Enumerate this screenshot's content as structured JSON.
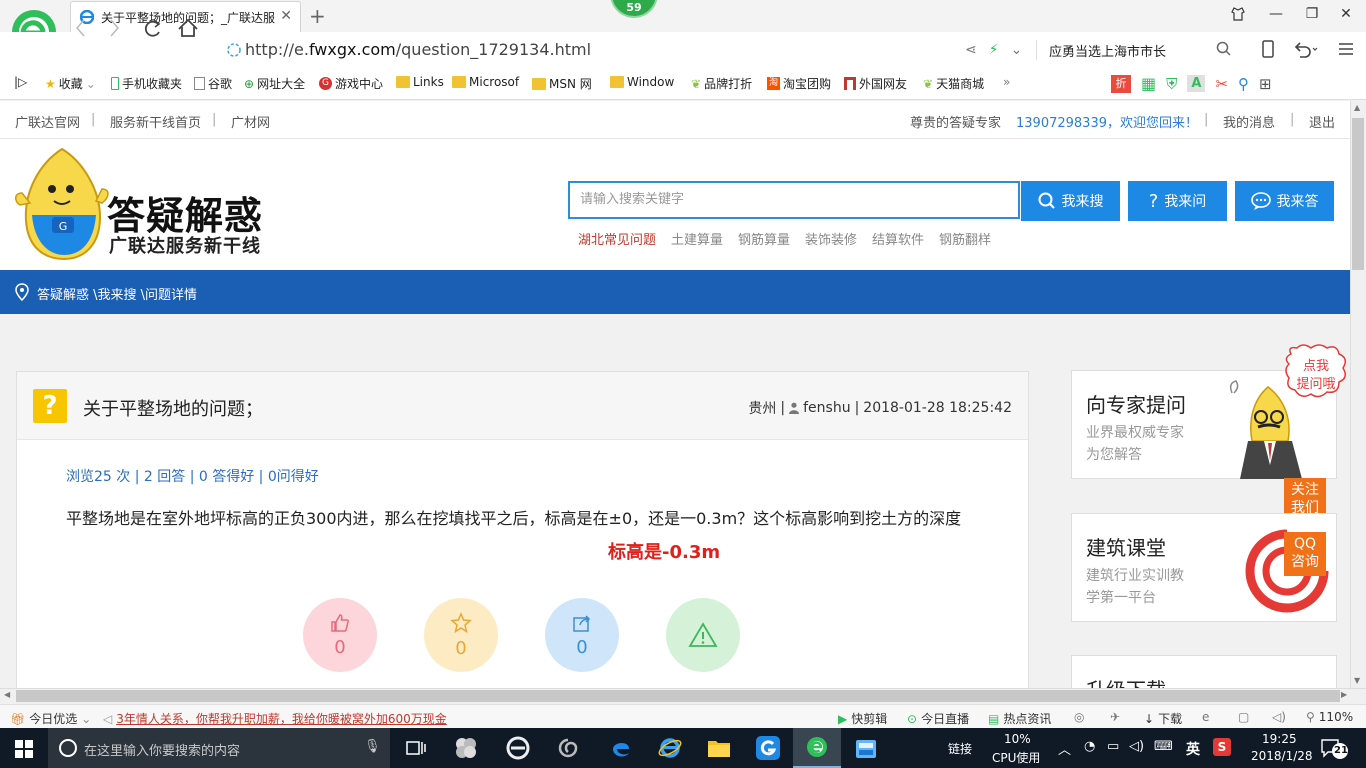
{
  "browser": {
    "tab_title": "关于平整场地的问题；_广联达服",
    "notification_count": "59",
    "url_prefix": "http://e.",
    "url_domain": "fwxgx.com",
    "url_path": "/question_1729134.html",
    "search_text": "应勇当选上海市市长"
  },
  "bookmarks": [
    {
      "label": "收藏",
      "icon": "star-icon"
    },
    {
      "label": "手机收藏夹",
      "icon": "phone-icon"
    },
    {
      "label": "谷歌",
      "icon": "page-icon"
    },
    {
      "label": "网址大全",
      "icon": "globe-icon"
    },
    {
      "label": "游戏中心",
      "icon": "game-icon"
    },
    {
      "label": "Links",
      "icon": "folder-icon"
    },
    {
      "label": "Microsof",
      "icon": "folder-icon"
    },
    {
      "label": "MSN 网",
      "icon": "folder-icon"
    },
    {
      "label": "Window",
      "icon": "folder-icon"
    },
    {
      "label": "品牌打折",
      "icon": "leaf-icon"
    },
    {
      "label": "淘宝团购",
      "icon": "taobao-icon"
    },
    {
      "label": "外国网友",
      "icon": "flag-icon"
    },
    {
      "label": "天猫商城",
      "icon": "leaf-icon"
    }
  ],
  "site": {
    "top_links": [
      "广联达官网",
      "服务新干线首页",
      "广材网"
    ],
    "greeting_prefix": "尊贵的答疑专家",
    "greeting_user": "13907298339，欢迎您回来！",
    "messages": "我的消息",
    "logout": "退出",
    "logo_title": "答疑解惑",
    "logo_subtitle": "广联达服务新干线",
    "search_placeholder": "请输入搜索关键字",
    "btn_search": "我来搜",
    "btn_ask": "我来问",
    "btn_answer": "我来答",
    "hot_links": [
      "湖北常见问题",
      "土建算量",
      "钢筋算量",
      "装饰装修",
      "结算软件",
      "钢筋翻样"
    ],
    "breadcrumb": "答疑解惑 \\我来搜 \\问题详情"
  },
  "question": {
    "title": "关于平整场地的问题；",
    "region": "贵州",
    "user": "fenshu",
    "datetime": "2018-01-28 18:25:42",
    "stats": "浏览25 次 | 2 回答 | 0 答得好 | 0问得好",
    "body": "平整场地是在室外地坪标高的正负300内进，那么在挖填找平之后，标高是在±0，还是一0.3m？这个标高影响到挖土方的深度",
    "answer_highlight": "标高是-0.3m",
    "actions": [
      {
        "icon": "thumbs-up-icon",
        "count": "0"
      },
      {
        "icon": "star-icon",
        "count": "0"
      },
      {
        "icon": "share-icon",
        "count": "0"
      },
      {
        "icon": "warning-icon",
        "count": ""
      }
    ]
  },
  "sidebar": {
    "expert_title": "向专家提问",
    "expert_sub1": "业界最权威专家",
    "expert_sub2": "为您解答",
    "bubble": "点我\n提问哦",
    "follow": "关注我们",
    "course_title": "建筑课堂",
    "course_sub1": "建筑行业实训教",
    "course_sub2": "学第一平台",
    "qq": "QQ咨询",
    "upgrade_title": "升级下载"
  },
  "statusbar": {
    "today": "今日优选",
    "news": "3年情人关系，你帮我升职加薪，我给你暖被窝外加600万现金",
    "quick_cut": "快剪辑",
    "live": "今日直播",
    "hot_news": "热点资讯",
    "download": "下载",
    "zoom": "110%"
  },
  "taskbar": {
    "search_placeholder": "在这里输入你要搜索的内容",
    "link": "链接",
    "cpu": "10%",
    "cpu_label": "CPU使用",
    "ime": "英",
    "time": "19:25",
    "date": "2018/1/28",
    "notifications": "21"
  }
}
